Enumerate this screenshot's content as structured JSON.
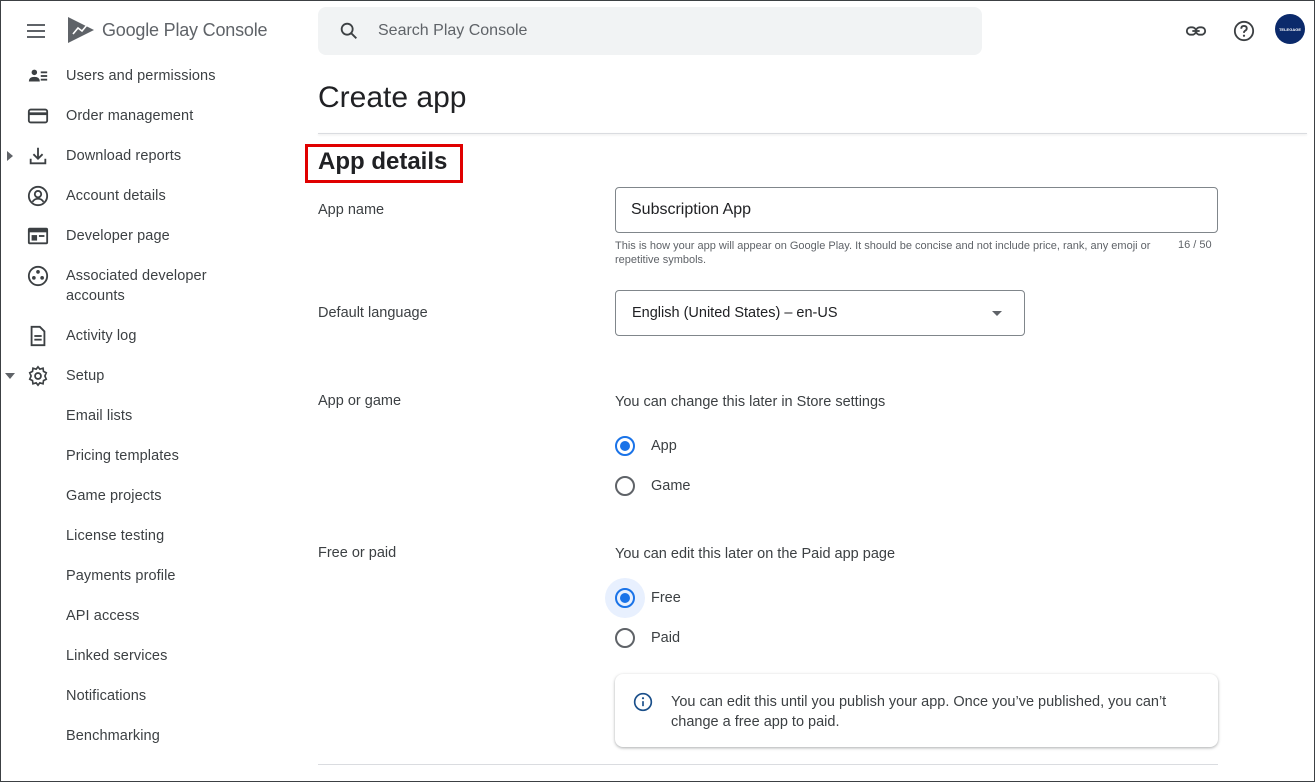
{
  "header": {
    "logo_text": "Google Play Console",
    "search_placeholder": "Search Play Console",
    "avatar_text": "TELEGAGE"
  },
  "sidebar": {
    "items": [
      {
        "label": "Users and permissions",
        "icon": "people-icon"
      },
      {
        "label": "Order management",
        "icon": "credit-card-icon"
      },
      {
        "label": "Download reports",
        "icon": "download-icon",
        "expandable": true
      },
      {
        "label": "Account details",
        "icon": "account-circle-icon"
      },
      {
        "label": "Developer page",
        "icon": "web-page-icon"
      },
      {
        "label": "Associated developer accounts",
        "icon": "linked-accounts-icon"
      },
      {
        "label": "Activity log",
        "icon": "document-icon"
      },
      {
        "label": "Setup",
        "icon": "gear-icon",
        "expanded": true
      },
      {
        "label": "Email lists"
      },
      {
        "label": "Pricing templates"
      },
      {
        "label": "Game projects"
      },
      {
        "label": "License testing"
      },
      {
        "label": "Payments profile"
      },
      {
        "label": "API access"
      },
      {
        "label": "Linked services"
      },
      {
        "label": "Notifications"
      },
      {
        "label": "Benchmarking"
      }
    ]
  },
  "main": {
    "title": "Create app",
    "section_title": "App details",
    "app_name": {
      "label": "App name",
      "value": "Subscription App",
      "helper": "This is how your app will appear on Google Play. It should be concise and not include price, rank, any emoji or repetitive symbols.",
      "counter": "16 / 50"
    },
    "default_language": {
      "label": "Default language",
      "value": "English (United States) – en-US"
    },
    "app_or_game": {
      "label": "App or game",
      "hint": "You can change this later in Store settings",
      "options": [
        "App",
        "Game"
      ],
      "selected": "App"
    },
    "free_or_paid": {
      "label": "Free or paid",
      "hint": "You can edit this later on the Paid app page",
      "options": [
        "Free",
        "Paid"
      ],
      "selected": "Free"
    },
    "info": "You can edit this until you publish your app. Once you’ve published, you can’t change a free app to paid."
  },
  "colors": {
    "accent": "#1a73e8",
    "highlight_box": "#e00000"
  }
}
